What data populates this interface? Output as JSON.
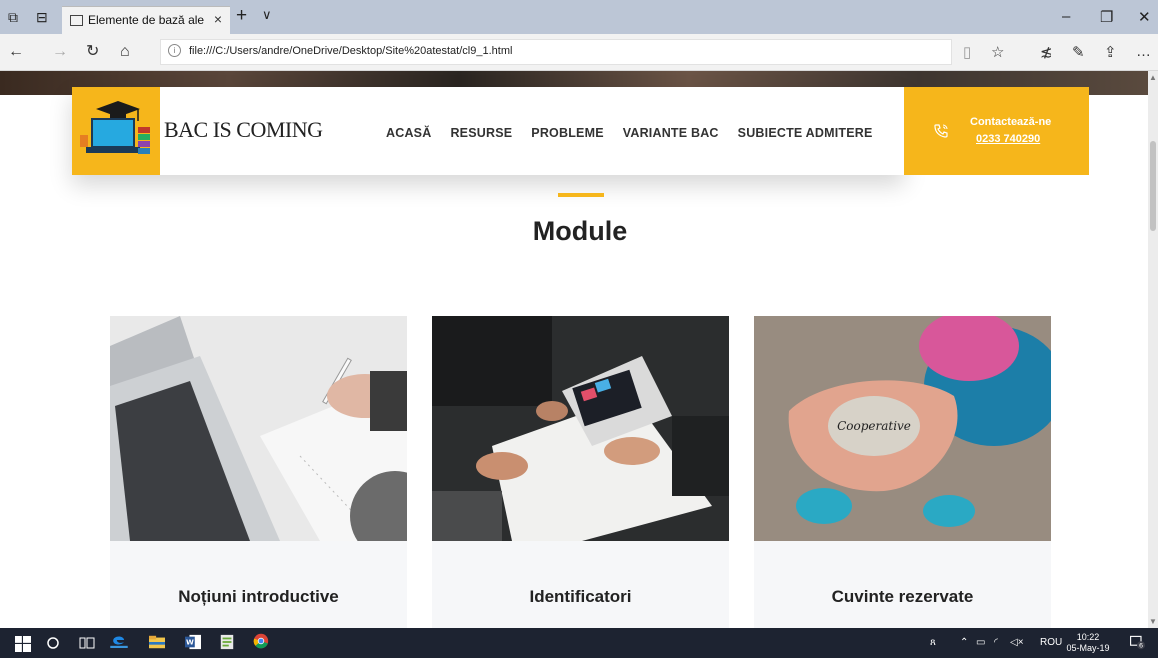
{
  "browser": {
    "tab_title": "Elemente de bază ale lir",
    "tab_close": "×",
    "new_tab": "+",
    "tab_dropdown": "∨",
    "url": "file:///C:/Users/andre/OneDrive/Desktop/Site%20atestat/cl9_1.html"
  },
  "site": {
    "brand": "BAC IS COMING",
    "menu": [
      "ACASĂ",
      "RESURSE",
      "PROBLEME",
      "VARIANTE BAC",
      "SUBIECTE ADMITERE"
    ],
    "contact_label": "Contactează-ne",
    "contact_phone": "0233 740290"
  },
  "section": {
    "title": "Module",
    "cards": [
      {
        "title": "Noțiuni introductive"
      },
      {
        "title": "Identificatori"
      },
      {
        "title": "Cuvinte rezervate"
      }
    ],
    "stone_text": "Cooperative"
  },
  "taskbar": {
    "language": "ROU",
    "time": "10:22",
    "date": "05-May-19",
    "notifications": "6"
  },
  "colors": {
    "accent": "#f6b61b",
    "taskbar": "#1d2331",
    "tabbar": "#bcc6d6"
  }
}
